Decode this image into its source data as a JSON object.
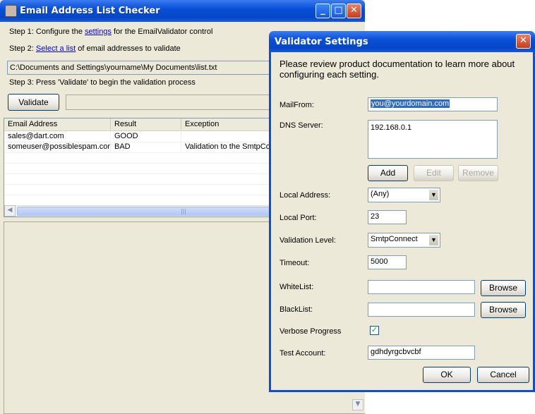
{
  "main_window": {
    "title": "Email Address List Checker",
    "controls": {
      "minimize": "_",
      "maximize": "□",
      "close": "✕"
    },
    "step1": {
      "prefix": "Step 1:  Configure the ",
      "link": "settings",
      "suffix": " for the EmailValidator control"
    },
    "step2": {
      "prefix": "Step 2:  ",
      "link": "Select  a list",
      "suffix": " of email addresses to validate"
    },
    "file_path": "C:\\Documents and Settings\\yourname\\My Documents\\list.txt",
    "step3": "Step 3: Press 'Validate' to begin the validation process",
    "validate_label": "Validate",
    "grid": {
      "columns": [
        "Email Address",
        "Result",
        "Exception"
      ],
      "rows": [
        [
          "sales@dart.com",
          "GOOD",
          ""
        ],
        [
          "someuser@possiblespam.com",
          "BAD",
          "Validation to the SmtpConnect"
        ]
      ]
    },
    "icons": {
      "app": "envelope-check-icon",
      "scroll_left": "arrow-left-icon",
      "scroll_grip": "scroll-grip-icon",
      "scroll_down": "arrow-down-icon"
    },
    "glyphs": {
      "left": "◀",
      "grip": "|||",
      "down": "▼"
    }
  },
  "dialog": {
    "title": "Validator Settings",
    "close": "✕",
    "intro": "Please review product documentation to learn more about configuring each setting.",
    "mailfrom": {
      "label": "MailFrom:",
      "value": "you@yourdomain.com"
    },
    "dns": {
      "label": "DNS Server:",
      "entries": [
        "192.168.0.1"
      ],
      "add": "Add",
      "edit": "Edit",
      "remove": "Remove"
    },
    "local_address": {
      "label": "Local Address:",
      "value": "(Any)"
    },
    "local_port": {
      "label": "Local Port:",
      "value": "23"
    },
    "validation_level": {
      "label": "Validation Level:",
      "value": "SmtpConnect"
    },
    "timeout": {
      "label": "Timeout:",
      "value": "5000"
    },
    "whitelist": {
      "label": "WhiteList:",
      "value": "",
      "browse": "Browse"
    },
    "blacklist": {
      "label": "BlackList:",
      "value": "",
      "browse": "Browse"
    },
    "verbose": {
      "label": "Verbose Progress",
      "checked": true,
      "mark": "✓"
    },
    "test_account": {
      "label": "Test Account:",
      "value": "gdhdyrgcbvcbf"
    },
    "ok": "OK",
    "cancel": "Cancel",
    "dropdown_glyph": "▼"
  }
}
